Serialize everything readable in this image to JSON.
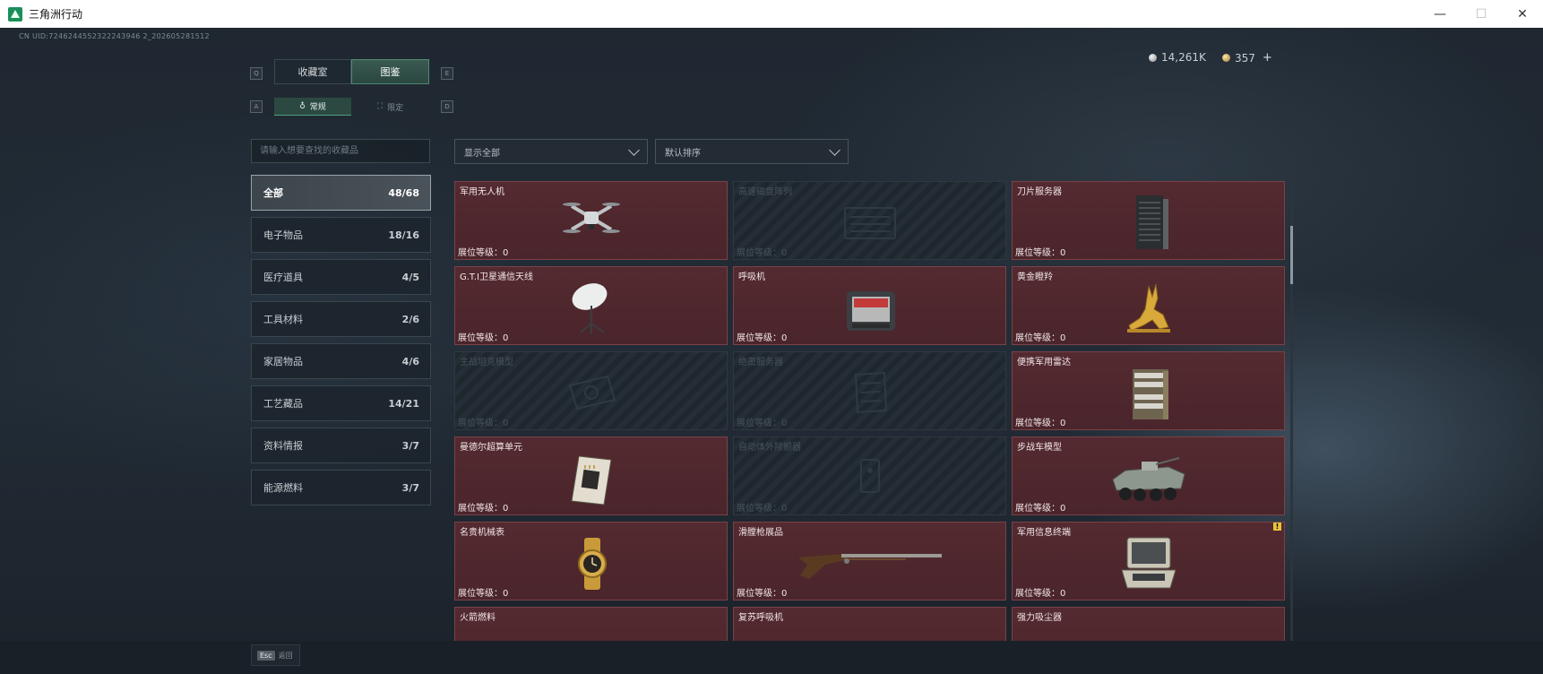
{
  "window": {
    "title": "三角洲行动",
    "minimize": "—",
    "maximize": "☐",
    "close": "✕"
  },
  "uid": "CN UID:7246244552322243946 2_202605281512",
  "currency": {
    "silver": "14,261K",
    "gold": "357",
    "plus": "+"
  },
  "keys": {
    "q": "Q",
    "e": "E",
    "a": "A",
    "d": "D"
  },
  "tabs": [
    {
      "label": "收藏室"
    },
    {
      "label": "图鉴"
    }
  ],
  "subtabs": [
    {
      "label": "常规",
      "glyph": "♁"
    },
    {
      "label": "限定",
      "glyph": "⛶"
    }
  ],
  "search": {
    "placeholder": "请输入想要查找的收藏品"
  },
  "categories": [
    {
      "label": "全部",
      "count": "48/68"
    },
    {
      "label": "电子物品",
      "count": "18/16"
    },
    {
      "label": "医疗道具",
      "count": "4/5"
    },
    {
      "label": "工具材料",
      "count": "2/6"
    },
    {
      "label": "家居物品",
      "count": "4/6"
    },
    {
      "label": "工艺藏品",
      "count": "14/21"
    },
    {
      "label": "资料情报",
      "count": "3/7"
    },
    {
      "label": "能源燃料",
      "count": "3/7"
    }
  ],
  "filters": {
    "show": "显示全部",
    "sort": "默认排序"
  },
  "items": [
    {
      "name": "军用无人机",
      "level": "展位等级：0",
      "icon": "drone-icon"
    },
    {
      "name": "高速磁盘阵列",
      "level": "展位等级：0",
      "icon": "disk-array-icon"
    },
    {
      "name": "刀片服务器",
      "level": "展位等级：0",
      "icon": "blade-server-icon"
    },
    {
      "name": "G.T.I卫星通信天线",
      "level": "展位等级：0",
      "icon": "satellite-dish-icon"
    },
    {
      "name": "呼吸机",
      "level": "展位等级：0",
      "icon": "ventilator-icon"
    },
    {
      "name": "黄金瞪羚",
      "level": "展位等级：0",
      "icon": "gazelle-icon"
    },
    {
      "name": "主战坦克模型",
      "level": "展位等级：0",
      "icon": "tank-model-icon"
    },
    {
      "name": "绝密服务器",
      "level": "展位等级：0",
      "icon": "secret-server-icon"
    },
    {
      "name": "便携军用雷达",
      "level": "展位等级：0",
      "icon": "radar-icon"
    },
    {
      "name": "曼德尔超算单元",
      "level": "展位等级：0",
      "icon": "supercomputer-icon"
    },
    {
      "name": "自动体外除颤器",
      "level": "展位等级：0",
      "icon": "defibrillator-icon"
    },
    {
      "name": "步战车模型",
      "level": "展位等级：0",
      "icon": "ifv-model-icon"
    },
    {
      "name": "名贵机械表",
      "level": "展位等级：0",
      "icon": "watch-icon"
    },
    {
      "name": "滑膛枪展品",
      "level": "展位等级：0",
      "icon": "musket-icon"
    },
    {
      "name": "军用信息终端",
      "level": "展位等级：0",
      "icon": "terminal-icon"
    },
    {
      "name": "火箭燃料",
      "level": "",
      "icon": "fuel-icon"
    },
    {
      "name": "复苏呼吸机",
      "level": "",
      "icon": "respirator-icon"
    },
    {
      "name": "强力吸尘器",
      "level": "",
      "icon": "vacuum-icon"
    }
  ],
  "warning_badge": "!",
  "footer": {
    "esc_key": "Esc",
    "back_label": "返回"
  },
  "colors": {
    "owned_card": "#532a30",
    "active_tab": "#3a5a50",
    "accent": "#4e8a74"
  }
}
